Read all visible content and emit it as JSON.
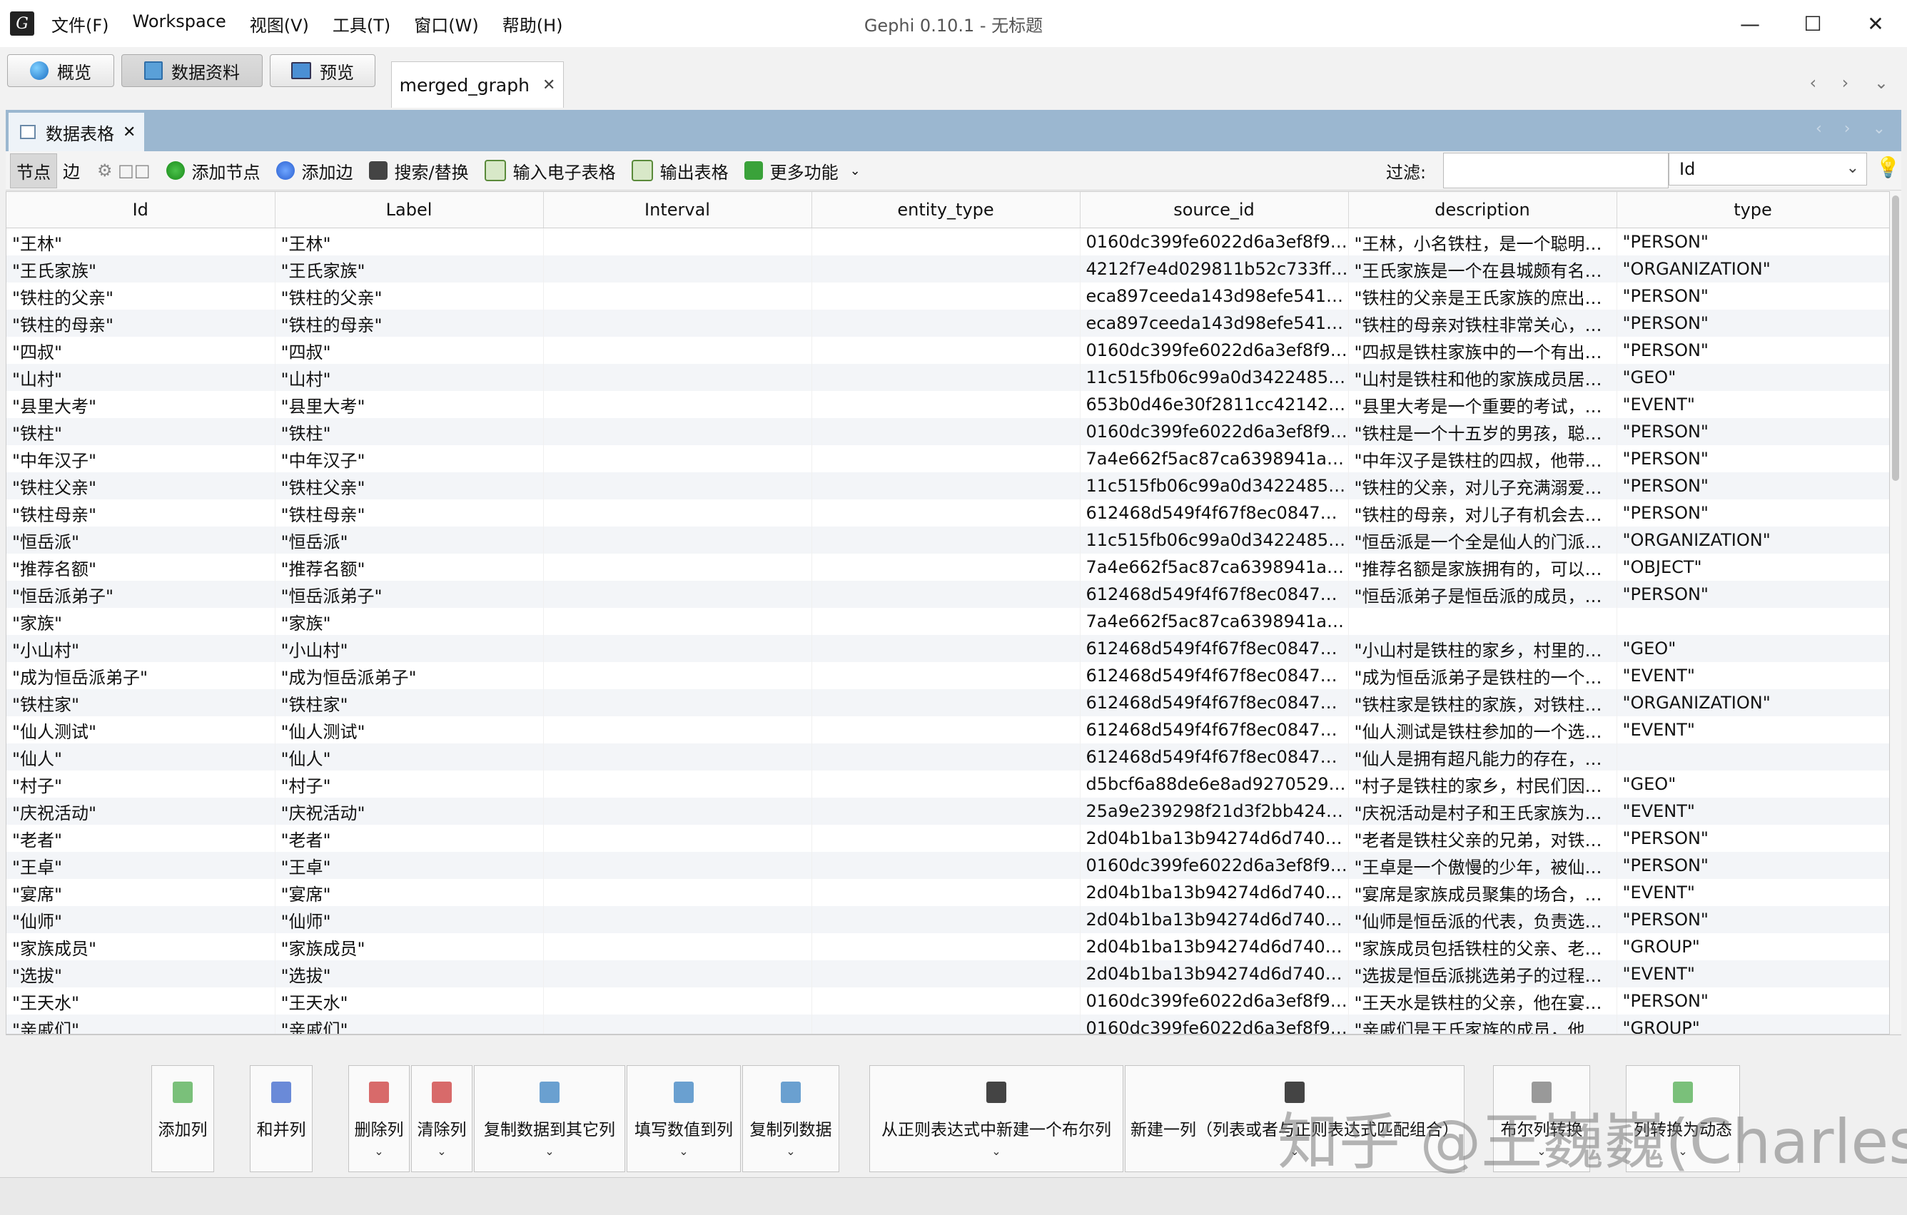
{
  "window": {
    "title": "Gephi 0.10.1 - 无标题",
    "menu": [
      "文件(F)",
      "Workspace",
      "视图(V)",
      "工具(T)",
      "窗口(W)",
      "帮助(H)"
    ]
  },
  "modes": {
    "overview": "概览",
    "data_lab": "数据资料",
    "preview": "预览"
  },
  "workspace_tab": "merged_graph",
  "panel_tab": "数据表格",
  "toolbar": {
    "nodes": "节点",
    "edges": "边",
    "add_node": "添加节点",
    "add_edge": "添加边",
    "search_replace": "搜索/替换",
    "import_sheet": "输入电子表格",
    "export_table": "输出表格",
    "more": "更多功能",
    "filter_label": "过滤:",
    "filter_value": "",
    "filter_column": "Id"
  },
  "table": {
    "columns": [
      "Id",
      "Label",
      "Interval",
      "entity_type",
      "source_id",
      "description",
      "type"
    ],
    "rows": [
      [
        "\"王林\"",
        "\"王林\"",
        "",
        "",
        "0160dc399fe6022d6a3ef8f91...",
        "\"王林，小名铁柱，是一个聪明且...",
        "\"PERSON\""
      ],
      [
        "\"王氏家族\"",
        "\"王氏家族\"",
        "",
        "",
        "4212f7e4d029811b52c733ff0...",
        "\"王氏家族是一个在县城颇有名气...",
        "\"ORGANIZATION\""
      ],
      [
        "\"铁柱的父亲\"",
        "\"铁柱的父亲\"",
        "",
        "",
        "eca897ceeda143d98efe541f3...",
        "\"铁柱的父亲是王氏家族的庶出次...",
        "\"PERSON\""
      ],
      [
        "\"铁柱的母亲\"",
        "\"铁柱的母亲\"",
        "",
        "",
        "eca897ceeda143d98efe541f3...",
        "\"铁柱的母亲对铁柱非常关心，支...",
        "\"PERSON\""
      ],
      [
        "\"四叔\"",
        "\"四叔\"",
        "",
        "",
        "0160dc399fe6022d6a3ef8f91...",
        "\"四叔是铁柱家族中的一个有出息...",
        "\"PERSON\""
      ],
      [
        "\"山村\"",
        "\"山村\"",
        "",
        "",
        "11c515fb06c99a0d3422485af...",
        "\"山村是铁柱和他的家族成员居住...",
        "\"GEO\""
      ],
      [
        "\"县里大考\"",
        "\"县里大考\"",
        "",
        "",
        "653b0d46e30f2811cc42142d2...",
        "\"县里大考是一个重要的考试，关...",
        "\"EVENT\""
      ],
      [
        "\"铁柱\"",
        "\"铁柱\"",
        "",
        "",
        "0160dc399fe6022d6a3ef8f91...",
        "\"铁柱是一个十五岁的男孩，聪明...",
        "\"PERSON\""
      ],
      [
        "\"中年汉子\"",
        "\"中年汉子\"",
        "",
        "",
        "7a4e662f5ac87ca6398941a5b...",
        "\"中年汉子是铁柱的四叔，他带来...",
        "\"PERSON\""
      ],
      [
        "\"铁柱父亲\"",
        "\"铁柱父亲\"",
        "",
        "",
        "11c515fb06c99a0d3422485af...",
        "\"铁柱的父亲，对儿子充满溺爱，...",
        "\"PERSON\""
      ],
      [
        "\"铁柱母亲\"",
        "\"铁柱母亲\"",
        "",
        "",
        "612468d549f4f67f8ec08476a2...",
        "\"铁柱的母亲，对儿子有机会去恒...",
        "\"PERSON\""
      ],
      [
        "\"恒岳派\"",
        "\"恒岳派\"",
        "",
        "",
        "11c515fb06c99a0d3422485af...",
        "\"恒岳派是一个全是仙人的门派，...",
        "\"ORGANIZATION\""
      ],
      [
        "\"推荐名额\"",
        "\"推荐名额\"",
        "",
        "",
        "7a4e662f5ac87ca6398941a5b...",
        "\"推荐名额是家族拥有的，可以让...",
        "\"OBJECT\""
      ],
      [
        "\"恒岳派弟子\"",
        "\"恒岳派弟子\"",
        "",
        "",
        "612468d549f4f67f8ec08476a2...",
        "\"恒岳派弟子是恒岳派的成员，铁...",
        "\"PERSON\""
      ],
      [
        "\"家族\"",
        "\"家族\"",
        "",
        "",
        "7a4e662f5ac87ca6398941a5b...",
        "",
        ""
      ],
      [
        "\"小山村\"",
        "\"小山村\"",
        "",
        "",
        "612468d549f4f67f8ec08476a2...",
        "\"小山村是铁柱的家乡，村里的人...",
        "\"GEO\""
      ],
      [
        "\"成为恒岳派弟子\"",
        "\"成为恒岳派弟子\"",
        "",
        "",
        "612468d549f4f67f8ec08476a2...",
        "\"成为恒岳派弟子是铁柱的一个重...",
        "\"EVENT\""
      ],
      [
        "\"铁柱家\"",
        "\"铁柱家\"",
        "",
        "",
        "612468d549f4f67f8ec08476a2...",
        "\"铁柱家是铁柱的家族，对铁柱的...",
        "\"ORGANIZATION\""
      ],
      [
        "\"仙人测试\"",
        "\"仙人测试\"",
        "",
        "",
        "612468d549f4f67f8ec08476a2...",
        "\"仙人测试是铁柱参加的一个选拔...",
        "\"EVENT\""
      ],
      [
        "\"仙人\"",
        "\"仙人\"",
        "",
        "",
        "612468d549f4f67f8ec08476a2...",
        "\"仙人是拥有超凡能力的存在，居...",
        ""
      ],
      [
        "\"村子\"",
        "\"村子\"",
        "",
        "",
        "d5bcf6a88de6e8ad9270529c...",
        "\"村子是铁柱的家乡，村民们因为...",
        "\"GEO\""
      ],
      [
        "\"庆祝活动\"",
        "\"庆祝活动\"",
        "",
        "",
        "25a9e239298f21d3f2bb4244e...",
        "\"庆祝活动是村子和王氏家族为铁...",
        "\"EVENT\""
      ],
      [
        "\"老者\"",
        "\"老者\"",
        "",
        "",
        "2d04b1ba13b94274d6d740ca...",
        "\"老者是铁柱父亲的兄弟，对铁柱...",
        "\"PERSON\""
      ],
      [
        "\"王卓\"",
        "\"王卓\"",
        "",
        "",
        "0160dc399fe6022d6a3ef8f91...",
        "\"王卓是一个傲慢的少年，被仙师...",
        "\"PERSON\""
      ],
      [
        "\"宴席\"",
        "\"宴席\"",
        "",
        "",
        "2d04b1ba13b94274d6d740ca...",
        "\"宴席是家族成员聚集的场合，讨...",
        "\"EVENT\""
      ],
      [
        "\"仙师\"",
        "\"仙师\"",
        "",
        "",
        "2d04b1ba13b94274d6d740ca...",
        "\"仙师是恒岳派的代表，负责选拔...",
        "\"PERSON\""
      ],
      [
        "\"家族成员\"",
        "\"家族成员\"",
        "",
        "",
        "2d04b1ba13b94274d6d740ca...",
        "\"家族成员包括铁柱的父亲、老者...",
        "\"GROUP\""
      ],
      [
        "\"选拔\"",
        "\"选拔\"",
        "",
        "",
        "2d04b1ba13b94274d6d740ca...",
        "\"选拔是恒岳派挑选弟子的过程，...",
        "\"EVENT\""
      ],
      [
        "\"王天水\"",
        "\"王天水\"",
        "",
        "",
        "0160dc399fe6022d6a3ef8f91...",
        "\"王天水是铁柱的父亲，他在宴会...",
        "\"PERSON\""
      ],
      [
        "\"亲戚们\"",
        "\"亲戚们\"",
        "",
        "",
        "0160dc399fe6022d6a3ef8f91...",
        "\"亲戚们是王氏家族的成员，他们...",
        "\"GROUP\""
      ]
    ]
  },
  "bottom_buttons": [
    {
      "label": "添加列",
      "icon": "add-column-icon",
      "dropdown": false
    },
    {
      "label": "和并列",
      "icon": "merge-columns-icon",
      "dropdown": false
    },
    {
      "label": "删除列",
      "icon": "delete-column-icon",
      "dropdown": true
    },
    {
      "label": "清除列",
      "icon": "clear-column-icon",
      "dropdown": true
    },
    {
      "label": "复制数据到其它列",
      "icon": "copy-data-icon",
      "dropdown": true
    },
    {
      "label": "填写数值到列",
      "icon": "fill-values-icon",
      "dropdown": true
    },
    {
      "label": "复制列数据",
      "icon": "duplicate-column-icon",
      "dropdown": true
    },
    {
      "label": "从正则表达式中新建一个布尔列",
      "icon": "binoculars-icon",
      "dropdown": true
    },
    {
      "label": "新建一列（列表或者与正则表达式匹配组合）",
      "icon": "binoculars-icon",
      "dropdown": true
    },
    {
      "label": "布尔列转换",
      "icon": "boolean-icon",
      "dropdown": true
    },
    {
      "label": "列转换为动态",
      "icon": "convert-dynamic-icon",
      "dropdown": true
    }
  ],
  "watermark": "知乎 @王巍巍(Charles)"
}
